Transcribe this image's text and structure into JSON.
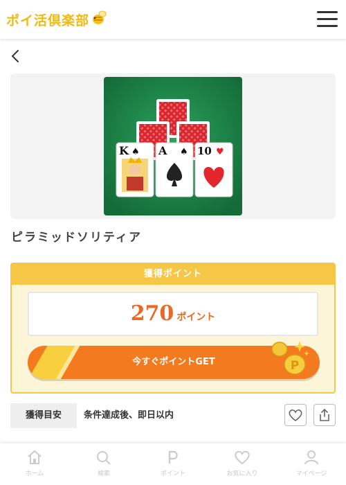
{
  "header": {
    "logo_text": "ポイ活倶楽部"
  },
  "main": {
    "title": "ピラミッドソリティア",
    "cards": [
      {
        "rank": "K",
        "suit": "♠"
      },
      {
        "rank": "A",
        "suit": "♠"
      },
      {
        "rank": "10",
        "suit": "♥"
      }
    ],
    "points": {
      "header_label": "獲得ポイント",
      "value": "270",
      "unit": "ポイント",
      "get_button_label": "今すぐポイントGET",
      "coin_mark": "P"
    },
    "estimate": {
      "label": "獲得目安",
      "text": "条件達成後、即日以内"
    }
  },
  "nav": {
    "items": [
      {
        "label": "ホーム",
        "icon": "home-icon"
      },
      {
        "label": "検索",
        "icon": "search-icon"
      },
      {
        "label": "ポイント",
        "icon": "point-icon"
      },
      {
        "label": "お気に入り",
        "icon": "heart-icon"
      },
      {
        "label": "マイページ",
        "icon": "user-icon"
      }
    ]
  },
  "colors": {
    "brand": "#f2b90f",
    "accent_orange": "#f47a20",
    "points_text": "#ea6a24",
    "point_box_border": "#f4c64a",
    "game_green": "#1f8a4c"
  }
}
